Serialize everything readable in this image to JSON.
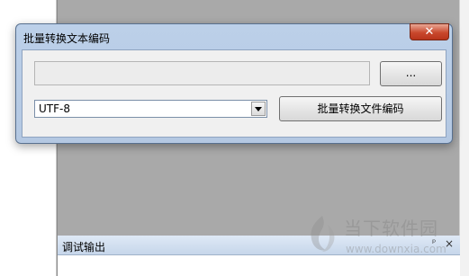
{
  "dialog": {
    "title": "批量转换文本编码",
    "close_label": "✕",
    "path_input": {
      "value": "",
      "placeholder": ""
    },
    "browse_button_label": "...",
    "encoding_select": {
      "selected": "UTF-8"
    },
    "convert_button_label": "批量转换文件编码"
  },
  "output_panel": {
    "title": "调试输出",
    "pin_icon": "📌",
    "close_icon": "×"
  },
  "watermark": {
    "text": "当下软件园",
    "url": "www.downxia.com"
  },
  "icons": {
    "close": "close-icon",
    "dropdown": "chevron-down-icon",
    "pin": "pin-icon"
  },
  "colors": {
    "workspace": "#a9a9a9",
    "close_button": "#c9482d",
    "title_bar": "#bcd0e9"
  }
}
